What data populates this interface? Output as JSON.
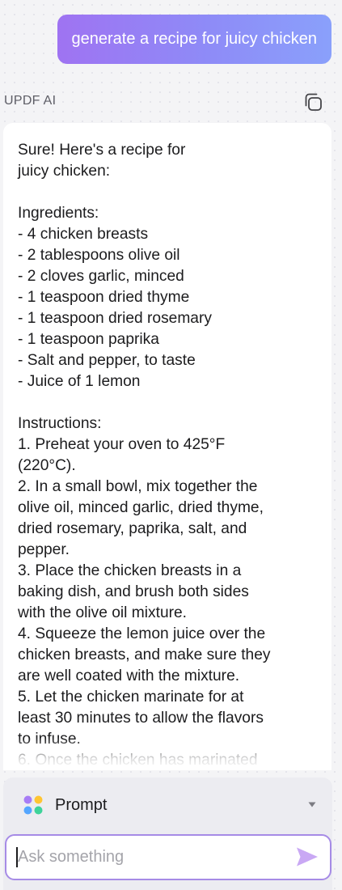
{
  "conversation": {
    "user_message": "generate a recipe for juicy chicken",
    "assistant": {
      "name": "UPDF AI",
      "copy_icon": "copy-icon",
      "response": "Sure! Here's a recipe for\njuicy chicken:\n\nIngredients:\n- 4 chicken breasts\n- 2 tablespoons olive oil\n- 2 cloves garlic, minced\n- 1 teaspoon dried thyme\n- 1 teaspoon dried rosemary\n- 1 teaspoon paprika\n- Salt and pepper, to taste\n- Juice of 1 lemon\n\nInstructions:\n1. Preheat your oven to 425°F\n(220°C).\n2. In a small bowl, mix together the\nolive oil, minced garlic, dried thyme,\ndried rosemary, paprika, salt, and\npepper.\n3. Place the chicken breasts in a\nbaking dish, and brush both sides\nwith the olive oil mixture.\n4. Squeeze the lemon juice over the\nchicken breasts, and make sure they\nare well coated with the mixture.\n5. Let the chicken marinate for at\nleast 30 minutes to allow the flavors\nto infuse.\n6. Once the chicken has marinated"
    }
  },
  "composer": {
    "prompt_selector": {
      "label": "Prompt",
      "icon": "four-dots-icon",
      "dropdown_icon": "caret-down-icon"
    },
    "input": {
      "placeholder": "Ask something",
      "value": ""
    },
    "send_icon": "send-icon"
  },
  "colors": {
    "user_bubble_gradient_start": "#9f73f2",
    "user_bubble_gradient_end": "#8aa0fb",
    "input_border": "#a68be6",
    "send_icon": "#c9a8f4",
    "dot_purple": "#a77cf6",
    "dot_yellow": "#ffc533",
    "dot_blue": "#54a6ff",
    "dot_green": "#3ed39a"
  }
}
